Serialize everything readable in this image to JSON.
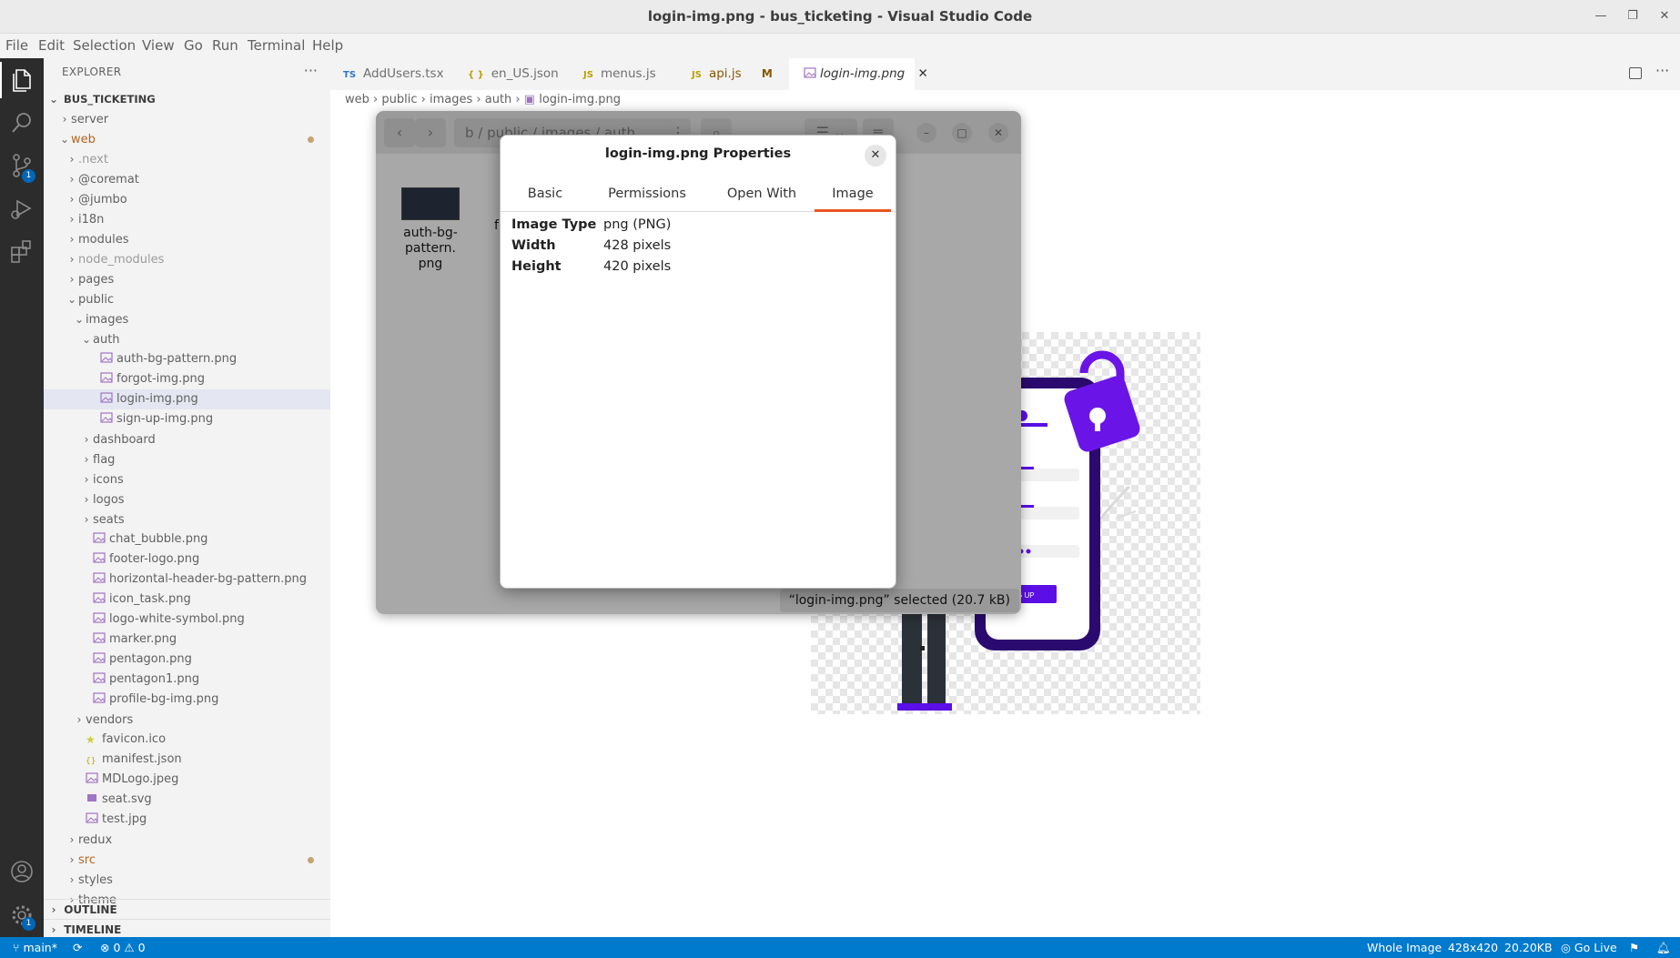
{
  "window": {
    "title": "login-img.png - bus_ticketing - Visual Studio Code"
  },
  "menu": [
    "File",
    "Edit",
    "Selection",
    "View",
    "Go",
    "Run",
    "Terminal",
    "Help"
  ],
  "activity": {
    "source_control_badge": "1",
    "settings_badge": "1"
  },
  "explorer": {
    "header": "EXPLORER",
    "more": "···",
    "root": "BUS_TICKETING",
    "tree": [
      {
        "label": "server",
        "depth": 1,
        "kind": "folder",
        "open": false
      },
      {
        "label": "web",
        "depth": 1,
        "kind": "folder",
        "open": true,
        "modified": true,
        "color": "#b5651d"
      },
      {
        "label": ".next",
        "depth": 2,
        "kind": "folder",
        "open": false,
        "muted": true
      },
      {
        "label": "@coremat",
        "depth": 2,
        "kind": "folder",
        "open": false
      },
      {
        "label": "@jumbo",
        "depth": 2,
        "kind": "folder",
        "open": false
      },
      {
        "label": "i18n",
        "depth": 2,
        "kind": "folder",
        "open": false
      },
      {
        "label": "modules",
        "depth": 2,
        "kind": "folder",
        "open": false
      },
      {
        "label": "node_modules",
        "depth": 2,
        "kind": "folder",
        "open": false,
        "muted": true
      },
      {
        "label": "pages",
        "depth": 2,
        "kind": "folder",
        "open": false
      },
      {
        "label": "public",
        "depth": 2,
        "kind": "folder",
        "open": true
      },
      {
        "label": "images",
        "depth": 3,
        "kind": "folder",
        "open": true
      },
      {
        "label": "auth",
        "depth": 4,
        "kind": "folder",
        "open": true
      },
      {
        "label": "auth-bg-pattern.png",
        "depth": 5,
        "kind": "image"
      },
      {
        "label": "forgot-img.png",
        "depth": 5,
        "kind": "image"
      },
      {
        "label": "login-img.png",
        "depth": 5,
        "kind": "image",
        "selected": true
      },
      {
        "label": "sign-up-img.png",
        "depth": 5,
        "kind": "image"
      },
      {
        "label": "dashboard",
        "depth": 4,
        "kind": "folder",
        "open": false
      },
      {
        "label": "flag",
        "depth": 4,
        "kind": "folder",
        "open": false
      },
      {
        "label": "icons",
        "depth": 4,
        "kind": "folder",
        "open": false
      },
      {
        "label": "logos",
        "depth": 4,
        "kind": "folder",
        "open": false
      },
      {
        "label": "seats",
        "depth": 4,
        "kind": "folder",
        "open": false
      },
      {
        "label": "chat_bubble.png",
        "depth": 4,
        "kind": "image"
      },
      {
        "label": "footer-logo.png",
        "depth": 4,
        "kind": "image"
      },
      {
        "label": "horizontal-header-bg-pattern.png",
        "depth": 4,
        "kind": "image"
      },
      {
        "label": "icon_task.png",
        "depth": 4,
        "kind": "image"
      },
      {
        "label": "logo-white-symbol.png",
        "depth": 4,
        "kind": "image"
      },
      {
        "label": "marker.png",
        "depth": 4,
        "kind": "image"
      },
      {
        "label": "pentagon.png",
        "depth": 4,
        "kind": "image"
      },
      {
        "label": "pentagon1.png",
        "depth": 4,
        "kind": "image"
      },
      {
        "label": "profile-bg-img.png",
        "depth": 4,
        "kind": "image"
      },
      {
        "label": "vendors",
        "depth": 3,
        "kind": "folder",
        "open": false
      },
      {
        "label": "favicon.ico",
        "depth": 3,
        "kind": "star"
      },
      {
        "label": "manifest.json",
        "depth": 3,
        "kind": "json"
      },
      {
        "label": "MDLogo.jpeg",
        "depth": 3,
        "kind": "image"
      },
      {
        "label": "seat.svg",
        "depth": 3,
        "kind": "svg"
      },
      {
        "label": "test.jpg",
        "depth": 3,
        "kind": "image"
      },
      {
        "label": "redux",
        "depth": 2,
        "kind": "folder",
        "open": false
      },
      {
        "label": "src",
        "depth": 2,
        "kind": "folder",
        "open": false,
        "modified": true,
        "color": "#b5651d"
      },
      {
        "label": "styles",
        "depth": 2,
        "kind": "folder",
        "open": false
      },
      {
        "label": "theme",
        "depth": 2,
        "kind": "folder",
        "open": false
      }
    ],
    "outline": "OUTLINE",
    "timeline": "TIMELINE"
  },
  "tabs": [
    {
      "icon": "TS",
      "label": "AddUsers.tsx",
      "icon_color": "#3178c6"
    },
    {
      "icon": "{ }",
      "label": "en_US.json",
      "icon_color": "#b8a200"
    },
    {
      "icon": "JS",
      "label": "menus.js",
      "icon_color": "#b8a200"
    },
    {
      "icon": "JS",
      "label": "api.js",
      "icon_color": "#b8a200",
      "badge": "M",
      "label_color": "#895503"
    },
    {
      "icon": "img",
      "label": "login-img.png",
      "active": true
    }
  ],
  "breadcrumb": [
    "web",
    "public",
    "images",
    "auth",
    "login-img.png"
  ],
  "file_manager": {
    "path": "b  /  public  /  images  /  auth",
    "file_name": "auth-bg-pattern.png",
    "file_label_lines": [
      "auth-bg-",
      "pattern.",
      "png"
    ],
    "partial_label": "f",
    "status": "“login-img.png” selected  (20.7 kB)"
  },
  "properties_dialog": {
    "title": "login-img.png Properties",
    "tabs": [
      "Basic",
      "Permissions",
      "Open With",
      "Image"
    ],
    "active_tab": "Image",
    "rows": [
      {
        "key": "Image Type",
        "value": "png (PNG)"
      },
      {
        "key": "Width",
        "value": "428 pixels"
      },
      {
        "key": "Height",
        "value": "420 pixels"
      }
    ]
  },
  "preview": {
    "button_text": "G UP"
  },
  "statusbar": {
    "branch": "main*",
    "problems": "0",
    "warnings": "0",
    "right": [
      "Whole Image",
      "428x420",
      "20.20KB",
      "Go Live"
    ]
  },
  "colors": {
    "accent": "#007acc",
    "brand_purple": "#5b0ee6",
    "tab_underline": "#e95420"
  }
}
